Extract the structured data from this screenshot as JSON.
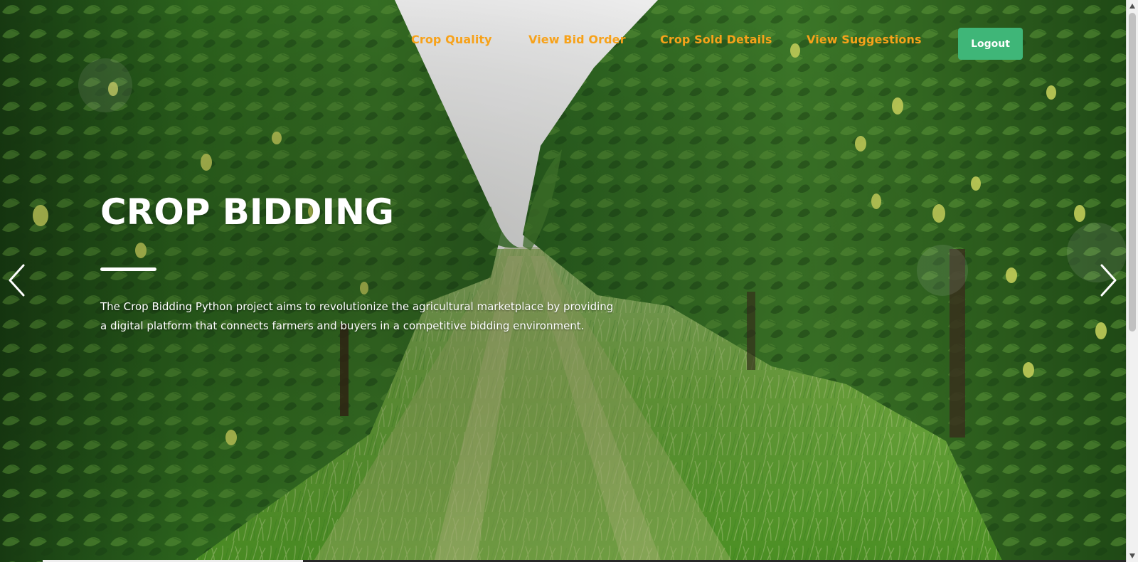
{
  "app": {
    "title": "CROP BIDDING",
    "description": "The Crop Bidding Python project aims to revolutionize the agricultural marketplace by providing a digital platform that connects farmers and buyers in a competitive bidding environment."
  },
  "navigation": {
    "items": [
      {
        "label": "Crop Quality",
        "icon": "none"
      },
      {
        "label": "View Bid Order",
        "icon": "none"
      },
      {
        "label": "Crop Sold Details",
        "icon": "none"
      },
      {
        "label": "View Suggestions",
        "icon": "none"
      }
    ],
    "logout_label": "Logout"
  },
  "carousel": {
    "previous_icon": "chevron-left-icon",
    "next_icon": "chevron-right-icon",
    "active_slide_fraction": 0.24
  },
  "colors": {
    "nav_link": "#f7a21a",
    "logout_button": "#3fb678",
    "hero_text": "#ffffff",
    "grass": "#66a33b",
    "foliage": "#2f6b22",
    "sky": "#f7f7f7"
  }
}
